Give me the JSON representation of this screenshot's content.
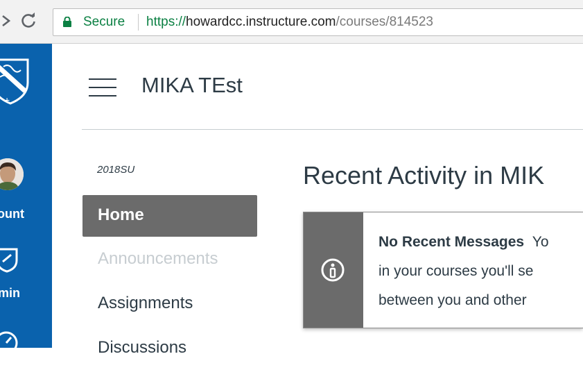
{
  "browser": {
    "secure_label": "Secure",
    "url_scheme": "https://",
    "url_host": "howardcc.instructure.com",
    "url_path": "/courses/814523"
  },
  "global_nav": {
    "account_label": "ount",
    "admin_label": "min"
  },
  "course": {
    "title": "MIKA TEst",
    "term": "2018SU"
  },
  "course_nav": {
    "items": [
      {
        "label": "Home",
        "active": true
      },
      {
        "label": "Announcements",
        "disabled": true
      },
      {
        "label": "Assignments"
      },
      {
        "label": "Discussions"
      }
    ]
  },
  "main": {
    "heading": "Recent Activity in MIK",
    "alert": {
      "title": "No Recent Messages",
      "line1_tail": "Yo",
      "line2": "in your courses you'll se",
      "line3": "between you and other"
    }
  },
  "colors": {
    "global_nav": "#0a62ad",
    "active_nav": "#6b6b6b",
    "secure_green": "#0b8043"
  }
}
